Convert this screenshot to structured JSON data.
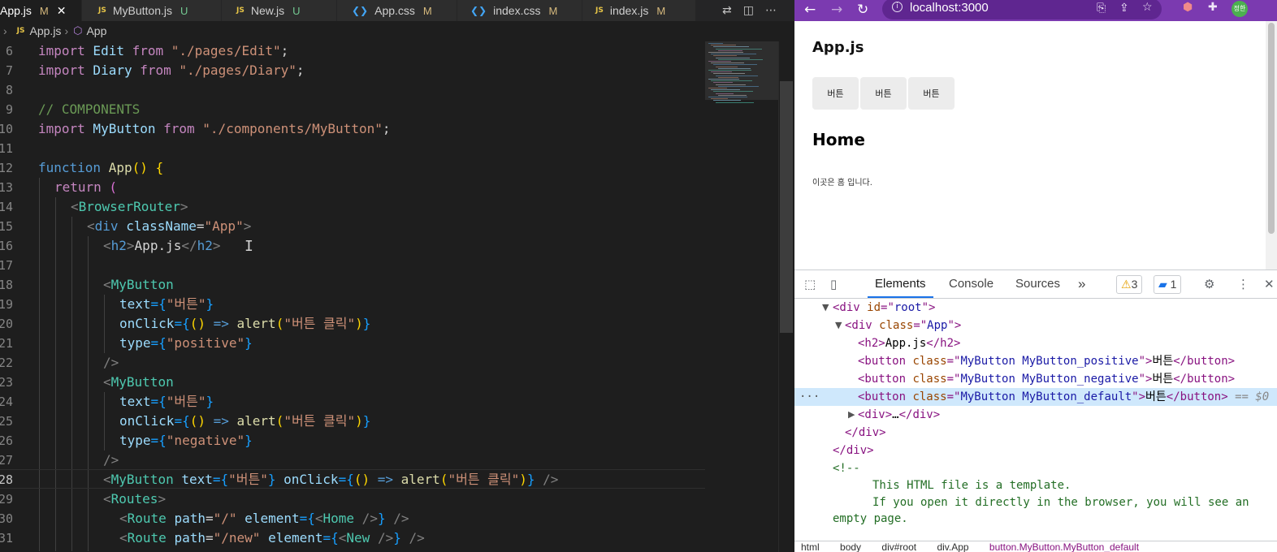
{
  "editor": {
    "tabs": [
      {
        "name": "App.js",
        "status": "M",
        "type": "js",
        "active": true
      },
      {
        "name": "MyButton.js",
        "status": "U",
        "type": "js"
      },
      {
        "name": "New.js",
        "status": "U",
        "type": "js"
      },
      {
        "name": "App.css",
        "status": "M",
        "type": "css"
      },
      {
        "name": "index.css",
        "status": "M",
        "type": "css"
      },
      {
        "name": "index.js",
        "status": "M",
        "type": "js"
      }
    ],
    "file_badge": "JS",
    "close_glyph": "✕",
    "breadcrumb": {
      "file": "App.js",
      "symbol": "App"
    },
    "line_numbers": [
      "6",
      "7",
      "8",
      "9",
      "10",
      "11",
      "12",
      "13",
      "14",
      "15",
      "16",
      "17",
      "18",
      "19",
      "20",
      "21",
      "22",
      "23",
      "24",
      "25",
      "26",
      "27",
      "28",
      "29",
      "30",
      "31"
    ],
    "code": {
      "l6": [
        "import",
        " Edit ",
        "from",
        " \"./pages/Edit\"",
        ";"
      ],
      "l7": [
        "import",
        " Diary ",
        "from",
        " \"./pages/Diary\"",
        ";"
      ],
      "l9": "// COMPONENTS",
      "l10": [
        "import",
        " MyButton ",
        "from",
        " \"./components/MyButton\"",
        ";"
      ],
      "l12": [
        "function",
        " ",
        "App",
        "() {"
      ],
      "l13": [
        "return",
        " ("
      ],
      "l14": [
        "<",
        "BrowserRouter",
        ">"
      ],
      "l15": [
        "<",
        "div",
        " ",
        "className",
        "=",
        "\"App\"",
        ">"
      ],
      "l16": [
        "<",
        "h2",
        ">",
        "App.js",
        "</",
        "h2",
        ">"
      ],
      "l18": [
        "<",
        "MyButton"
      ],
      "l19": [
        "text",
        "={",
        "\"버튼\"",
        "}"
      ],
      "l20": [
        "onClick",
        "={",
        "() ",
        "=>",
        " ",
        "alert",
        "(",
        "\"버튼 클릭\"",
        ")",
        "}"
      ],
      "l21": [
        "type",
        "={",
        "\"positive\"",
        "}"
      ],
      "l22": "/>",
      "l23": [
        "<",
        "MyButton"
      ],
      "l24": [
        "text",
        "={",
        "\"버튼\"",
        "}"
      ],
      "l25": [
        "onClick",
        "={",
        "() ",
        "=>",
        " ",
        "alert",
        "(",
        "\"버튼 클릭\"",
        ")",
        "}"
      ],
      "l26": [
        "type",
        "={",
        "\"negative\"",
        "}"
      ],
      "l27": "/>",
      "l28": [
        "<",
        "MyButton",
        " ",
        "text",
        "={",
        "\"버튼\"",
        "} ",
        "onClick",
        "={",
        "() ",
        "=>",
        " ",
        "alert",
        "(",
        "\"버튼 클릭\"",
        ")",
        "} ",
        "/>"
      ],
      "l29": [
        "<",
        "Routes",
        ">"
      ],
      "l30": [
        "<",
        "Route",
        " ",
        "path",
        "=",
        "\"/\"",
        " ",
        "element",
        "={",
        "<",
        "Home",
        " />",
        "} ",
        "/>"
      ],
      "l31": [
        "<",
        "Route",
        " ",
        "path",
        "=",
        "\"/new\"",
        " ",
        "element",
        "={",
        "<",
        "New",
        " />",
        "} ",
        "/>"
      ]
    }
  },
  "browser": {
    "url": "localhost:3000",
    "profile_initials": "정한",
    "page": {
      "title": "App.js",
      "buttons": [
        "버튼",
        "버튼",
        "버튼"
      ],
      "home_title": "Home",
      "home_text": "이곳은 홈 입니다."
    }
  },
  "devtools": {
    "tabs": [
      "Elements",
      "Console",
      "Sources"
    ],
    "more": "»",
    "warnings": "3",
    "messages": "1",
    "dom": {
      "d1": [
        "<div ",
        "id",
        "=\"",
        "root",
        "\">"
      ],
      "d2": [
        "<div ",
        "class",
        "=\"",
        "App",
        "\">"
      ],
      "d3": [
        "<h2>",
        "App.js",
        "</h2>"
      ],
      "d4": [
        "<button ",
        "class",
        "=\"",
        "MyButton MyButton_positive",
        "\">",
        "버튼",
        "</button>"
      ],
      "d5": [
        "<button ",
        "class",
        "=\"",
        "MyButton MyButton_negative",
        "\">",
        "버튼",
        "</button>"
      ],
      "d6": [
        "<button ",
        "class",
        "=\"",
        "MyButton MyButton_default",
        "\">",
        "버튼",
        "</button>",
        " == $0"
      ],
      "d7": [
        "<div>",
        "…",
        "</div>"
      ],
      "d8": "</div>",
      "d9": "</div>",
      "d10": "<!--",
      "d11": "This HTML file is a template.",
      "d12": "If you open it directly in the browser, you will see an",
      "d13": "empty page."
    },
    "crumbs": [
      "html",
      "body",
      "div#root",
      "div.App",
      "button.MyButton.MyButton_default"
    ]
  }
}
